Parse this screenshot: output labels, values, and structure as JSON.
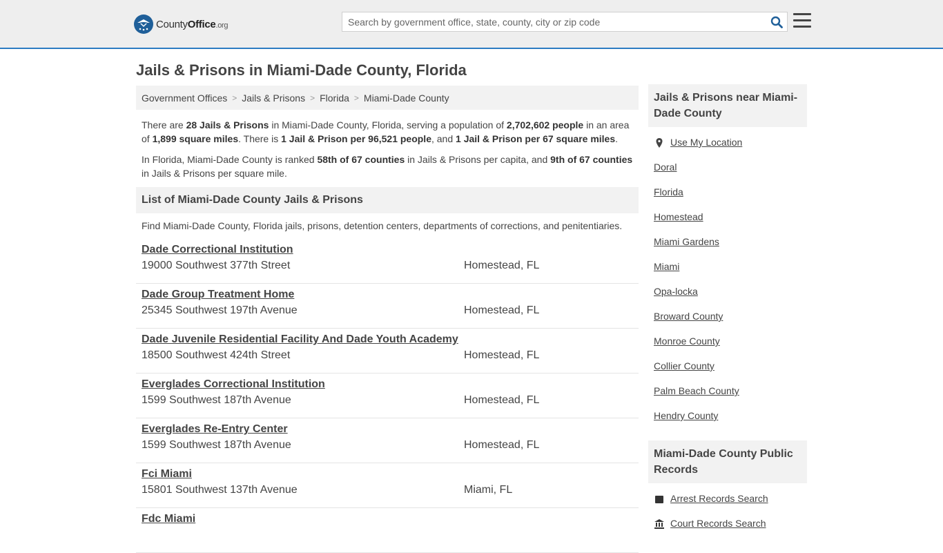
{
  "header": {
    "logo_county": "County",
    "logo_office": "Office",
    "logo_tld": ".org",
    "search_placeholder": "Search by government office, state, county, city or zip code"
  },
  "page_title": "Jails & Prisons in Miami-Dade County, Florida",
  "breadcrumb": [
    {
      "label": "Government Offices"
    },
    {
      "label": "Jails & Prisons"
    },
    {
      "label": "Florida"
    },
    {
      "label": "Miami-Dade County"
    }
  ],
  "intro": {
    "p1_a": "There are ",
    "p1_b": "28 Jails & Prisons",
    "p1_c": " in Miami-Dade County, Florida, serving a population of ",
    "p1_d": "2,702,602 people",
    "p1_e": " in an area of ",
    "p1_f": "1,899 square miles",
    "p1_g": ". There is ",
    "p1_h": "1 Jail & Prison per 96,521 people",
    "p1_i": ", and ",
    "p1_j": "1 Jail & Prison per 67 square miles",
    "p1_k": ".",
    "p2_a": "In Florida, Miami-Dade County is ranked ",
    "p2_b": "58th of 67 counties",
    "p2_c": " in Jails & Prisons per capita, and ",
    "p2_d": "9th of 67 counties",
    "p2_e": " in Jails & Prisons per square mile."
  },
  "list_section": {
    "heading": "List of Miami-Dade County Jails & Prisons",
    "description": "Find Miami-Dade County, Florida jails, prisons, detention centers, departments of corrections, and penitentiaries."
  },
  "listings": [
    {
      "name": "Dade Correctional Institution",
      "address": "19000 Southwest 377th Street",
      "city": "Homestead, FL"
    },
    {
      "name": "Dade Group Treatment Home",
      "address": "25345 Southwest 197th Avenue",
      "city": "Homestead, FL"
    },
    {
      "name": "Dade Juvenile Residential Facility And Dade Youth Academy",
      "address": "18500 Southwest 424th Street",
      "city": "Homestead, FL"
    },
    {
      "name": "Everglades Correctional Institution",
      "address": "1599 Southwest 187th Avenue",
      "city": "Homestead, FL"
    },
    {
      "name": "Everglades Re-Entry Center",
      "address": "1599 Southwest 187th Avenue",
      "city": "Homestead, FL"
    },
    {
      "name": "Fci Miami",
      "address": "15801 Southwest 137th Avenue",
      "city": "Miami, FL"
    },
    {
      "name": "Fdc Miami",
      "address": "",
      "city": ""
    }
  ],
  "sidebar": {
    "nearby_heading": "Jails & Prisons near Miami-Dade County",
    "use_location": "Use My Location",
    "nearby": [
      "Doral",
      "Florida",
      "Homestead",
      "Miami Gardens",
      "Miami",
      "Opa-locka",
      "Broward County",
      "Monroe County",
      "Collier County",
      "Palm Beach County",
      "Hendry County"
    ],
    "records_heading": "Miami-Dade County Public Records",
    "records": [
      "Arrest Records Search",
      "Court Records Search"
    ]
  }
}
